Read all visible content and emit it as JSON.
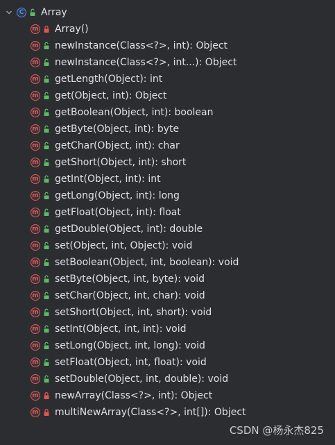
{
  "root": {
    "label": "Array",
    "icon": "class-icon",
    "visibility": "public"
  },
  "methods": [
    {
      "label": "Array()",
      "visibility": "private"
    },
    {
      "label": "newInstance(Class<?>, int): Object",
      "visibility": "public"
    },
    {
      "label": "newInstance(Class<?>, int...): Object",
      "visibility": "public"
    },
    {
      "label": "getLength(Object): int",
      "visibility": "public"
    },
    {
      "label": "get(Object, int): Object",
      "visibility": "public"
    },
    {
      "label": "getBoolean(Object, int): boolean",
      "visibility": "public"
    },
    {
      "label": "getByte(Object, int): byte",
      "visibility": "public"
    },
    {
      "label": "getChar(Object, int): char",
      "visibility": "public"
    },
    {
      "label": "getShort(Object, int): short",
      "visibility": "public"
    },
    {
      "label": "getInt(Object, int): int",
      "visibility": "public"
    },
    {
      "label": "getLong(Object, int): long",
      "visibility": "public"
    },
    {
      "label": "getFloat(Object, int): float",
      "visibility": "public"
    },
    {
      "label": "getDouble(Object, int): double",
      "visibility": "public"
    },
    {
      "label": "set(Object, int, Object): void",
      "visibility": "public"
    },
    {
      "label": "setBoolean(Object, int, boolean): void",
      "visibility": "public"
    },
    {
      "label": "setByte(Object, int, byte): void",
      "visibility": "public"
    },
    {
      "label": "setChar(Object, int, char): void",
      "visibility": "public"
    },
    {
      "label": "setShort(Object, int, short): void",
      "visibility": "public"
    },
    {
      "label": "setInt(Object, int, int): void",
      "visibility": "public"
    },
    {
      "label": "setLong(Object, int, long): void",
      "visibility": "public"
    },
    {
      "label": "setFloat(Object, int, float): void",
      "visibility": "public"
    },
    {
      "label": "setDouble(Object, int, double): void",
      "visibility": "public"
    },
    {
      "label": "newArray(Class<?>, int): Object",
      "visibility": "private"
    },
    {
      "label": "multiNewArray(Class<?>, int[]): Object",
      "visibility": "private"
    }
  ],
  "watermark": "CSDN @杨永杰825",
  "colors": {
    "background": "#2b2d30",
    "text": "#dfe1e5",
    "class_badge": "#548af7",
    "method_badge": "#db5c5c",
    "public_access": "#5fb865",
    "private_access": "#e05555"
  }
}
